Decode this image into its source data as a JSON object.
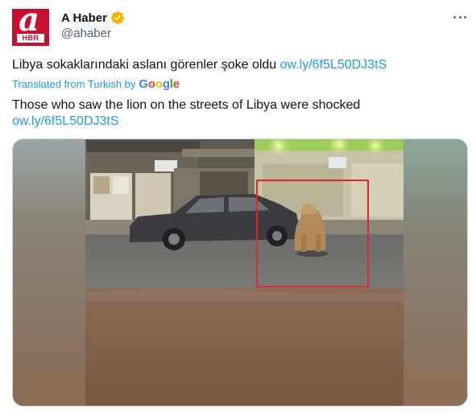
{
  "account": {
    "display_name": "A Haber",
    "handle": "@ahaber",
    "avatar_letter": "a",
    "avatar_badge": "HBR",
    "verified": true,
    "verified_color": "#f4b400"
  },
  "actions": {
    "more_icon": "more-horizontal-icon"
  },
  "tweet": {
    "original_text": "Libya sokaklarındaki aslanı görenler şoke oldu",
    "original_link": "ow.ly/6f5L50DJ3tS",
    "translated_by_label": "Translated from Turkish by",
    "translator": "Google",
    "translated_text": "Those who saw the lion on the streets of Libya were shocked",
    "translated_link": "ow.ly/6f5L50DJ3tS"
  },
  "media": {
    "type": "video-thumbnail",
    "highlight_color": "#e0252b"
  },
  "colors": {
    "brand_red": "#c8102e",
    "link_blue": "#1d9bf0",
    "secondary_text": "#536471"
  }
}
